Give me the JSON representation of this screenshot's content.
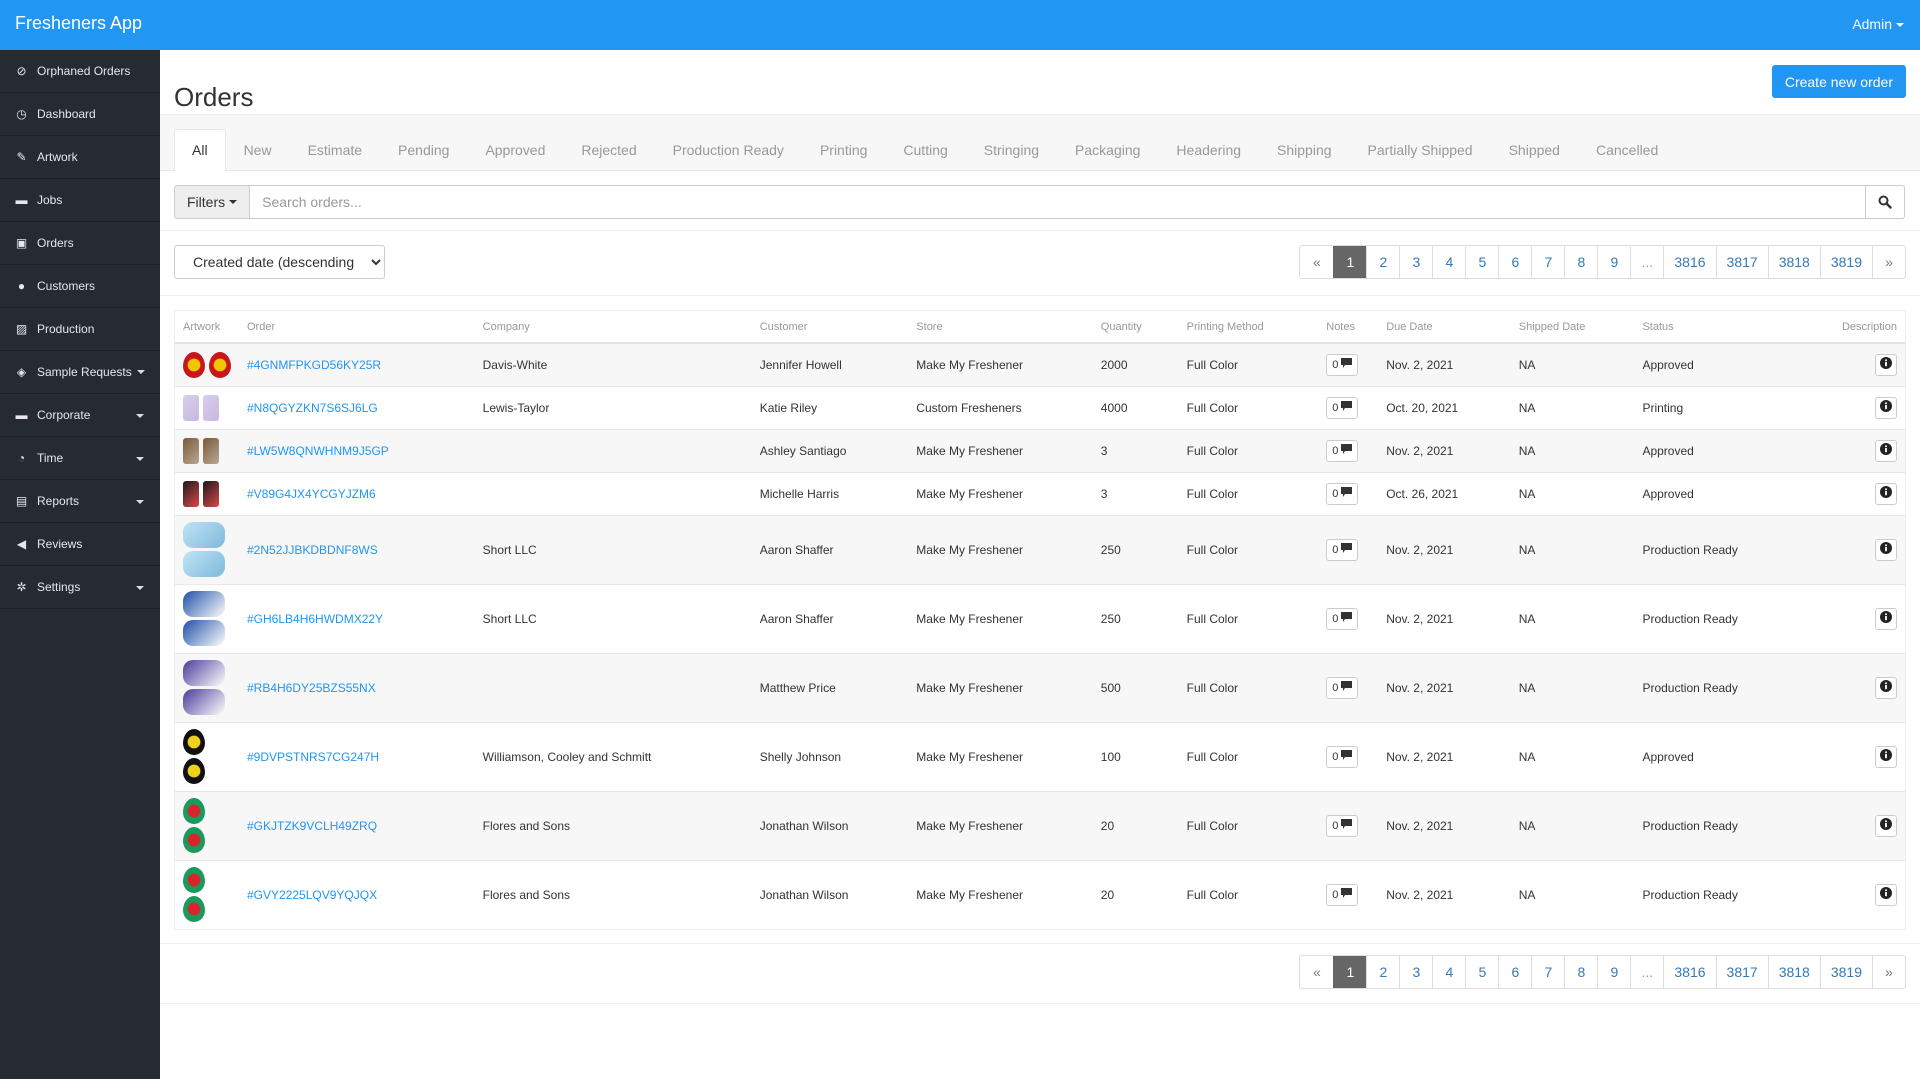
{
  "app": {
    "title": "Fresheners App",
    "user_menu": "Admin"
  },
  "sidebar": {
    "items": [
      {
        "label": "Orphaned Orders",
        "icon": "ban-icon",
        "glyph": "⊘",
        "has_caret": false
      },
      {
        "label": "Dashboard",
        "icon": "dashboard-icon",
        "glyph": "◷",
        "has_caret": false
      },
      {
        "label": "Artwork",
        "icon": "pushpin-icon",
        "glyph": "✎",
        "has_caret": false
      },
      {
        "label": "Jobs",
        "icon": "briefcase-icon",
        "glyph": "▬",
        "has_caret": false
      },
      {
        "label": "Orders",
        "icon": "inbox-icon",
        "glyph": "▣",
        "has_caret": false
      },
      {
        "label": "Customers",
        "icon": "user-icon",
        "glyph": "●",
        "has_caret": false
      },
      {
        "label": "Production",
        "icon": "picture-icon",
        "glyph": "▨",
        "has_caret": false
      },
      {
        "label": "Sample Requests",
        "icon": "tags-icon",
        "glyph": "◈",
        "has_caret": true,
        "caret_inline": true
      },
      {
        "label": "Corporate",
        "icon": "briefcase-icon",
        "glyph": "▬",
        "has_caret": true
      },
      {
        "label": "Time",
        "icon": "clock-icon",
        "glyph": "◔",
        "has_caret": true
      },
      {
        "label": "Reports",
        "icon": "list-alt-icon",
        "glyph": "▤",
        "has_caret": true
      },
      {
        "label": "Reviews",
        "icon": "bullhorn-icon",
        "glyph": "◀",
        "has_caret": false
      },
      {
        "label": "Settings",
        "icon": "cog-icon",
        "glyph": "✲",
        "has_caret": true
      }
    ]
  },
  "page": {
    "title": "Orders",
    "create_button": "Create new order"
  },
  "tabs": [
    "All",
    "New",
    "Estimate",
    "Pending",
    "Approved",
    "Rejected",
    "Production Ready",
    "Printing",
    "Cutting",
    "Stringing",
    "Packaging",
    "Headering",
    "Shipping",
    "Partially Shipped",
    "Shipped",
    "Cancelled"
  ],
  "active_tab": "All",
  "search": {
    "filters_label": "Filters",
    "placeholder": "Search orders...",
    "value": ""
  },
  "sort": {
    "selected": "Created date (descending)"
  },
  "pagination": {
    "prev": "«",
    "next": "»",
    "pages": [
      "1",
      "2",
      "3",
      "4",
      "5",
      "6",
      "7",
      "8",
      "9",
      "...",
      "3816",
      "3817",
      "3818",
      "3819"
    ],
    "current": "1"
  },
  "table": {
    "columns": [
      "Artwork",
      "Order",
      "Company",
      "Customer",
      "Store",
      "Quantity",
      "Printing Method",
      "Notes",
      "Due Date",
      "Shipped Date",
      "Status",
      "Description"
    ],
    "rows": [
      {
        "artwork": {
          "style": "side",
          "shape": "round",
          "colors": [
            "#c8161d",
            "#f5c400"
          ]
        },
        "order": "#4GNMFPKGD56KY25R",
        "company": "Davis-White",
        "customer": "Jennifer Howell",
        "store": "Make My Freshener",
        "quantity": "2000",
        "printing_method": "Full Color",
        "notes": "0",
        "due_date": "Nov. 2, 2021",
        "shipped_date": "NA",
        "status": "Approved"
      },
      {
        "artwork": {
          "style": "side",
          "shape": "rect",
          "colors": [
            "#d7d0ea",
            "#c9b6e0"
          ]
        },
        "order": "#N8QGYZKN7S6SJ6LG",
        "company": "Lewis-Taylor",
        "customer": "Katie Riley",
        "store": "Custom Fresheners",
        "quantity": "4000",
        "printing_method": "Full Color",
        "notes": "0",
        "due_date": "Oct. 20, 2021",
        "shipped_date": "NA",
        "status": "Printing"
      },
      {
        "artwork": {
          "style": "side",
          "shape": "rect",
          "colors": [
            "#7a5a3a",
            "#b9a894"
          ]
        },
        "order": "#LW5W8QNWHNM9J5GP",
        "company": "",
        "customer": "Ashley Santiago",
        "store": "Make My Freshener",
        "quantity": "3",
        "printing_method": "Full Color",
        "notes": "0",
        "due_date": "Nov. 2, 2021",
        "shipped_date": "NA",
        "status": "Approved"
      },
      {
        "artwork": {
          "style": "side",
          "shape": "rect",
          "colors": [
            "#1a1a1a",
            "#e0454a"
          ]
        },
        "order": "#V89G4JX4YCGYJZM6",
        "company": "",
        "customer": "Michelle Harris",
        "store": "Make My Freshener",
        "quantity": "3",
        "printing_method": "Full Color",
        "notes": "0",
        "due_date": "Oct. 26, 2021",
        "shipped_date": "NA",
        "status": "Approved"
      },
      {
        "artwork": {
          "style": "stack",
          "shape": "big",
          "colors": [
            "#bfe4f6",
            "#7fb8da"
          ]
        },
        "order": "#2N52JJBKDBDNF8WS",
        "company": "Short LLC",
        "customer": "Aaron Shaffer",
        "store": "Make My Freshener",
        "quantity": "250",
        "printing_method": "Full Color",
        "notes": "0",
        "due_date": "Nov. 2, 2021",
        "shipped_date": "NA",
        "status": "Production Ready"
      },
      {
        "artwork": {
          "style": "stack",
          "shape": "big",
          "colors": [
            "#1f4fa6",
            "#ffffff"
          ]
        },
        "order": "#GH6LB4H6HWDMX22Y",
        "company": "Short LLC",
        "customer": "Aaron Shaffer",
        "store": "Make My Freshener",
        "quantity": "250",
        "printing_method": "Full Color",
        "notes": "0",
        "due_date": "Nov. 2, 2021",
        "shipped_date": "NA",
        "status": "Production Ready"
      },
      {
        "artwork": {
          "style": "stack",
          "shape": "big",
          "colors": [
            "#4b3a9a",
            "#ffffff"
          ]
        },
        "order": "#RB4H6DY25BZS55NX",
        "company": "",
        "customer": "Matthew Price",
        "store": "Make My Freshener",
        "quantity": "500",
        "printing_method": "Full Color",
        "notes": "0",
        "due_date": "Nov. 2, 2021",
        "shipped_date": "NA",
        "status": "Production Ready"
      },
      {
        "artwork": {
          "style": "stack",
          "shape": "round",
          "colors": [
            "#111111",
            "#f1d21a"
          ]
        },
        "order": "#9DVPSTNRS7CG247H",
        "company": "Williamson, Cooley and Schmitt",
        "customer": "Shelly Johnson",
        "store": "Make My Freshener",
        "quantity": "100",
        "printing_method": "Full Color",
        "notes": "0",
        "due_date": "Nov. 2, 2021",
        "shipped_date": "NA",
        "status": "Approved"
      },
      {
        "artwork": {
          "style": "stack",
          "shape": "round",
          "colors": [
            "#1a9a5c",
            "#d8242b"
          ]
        },
        "order": "#GKJTZK9VCLH49ZRQ",
        "company": "Flores and Sons",
        "customer": "Jonathan Wilson",
        "store": "Make My Freshener",
        "quantity": "20",
        "printing_method": "Full Color",
        "notes": "0",
        "due_date": "Nov. 2, 2021",
        "shipped_date": "NA",
        "status": "Production Ready"
      },
      {
        "artwork": {
          "style": "stack",
          "shape": "round",
          "colors": [
            "#1a9a5c",
            "#d8242b"
          ]
        },
        "order": "#GVY2225LQV9YQJQX",
        "company": "Flores and Sons",
        "customer": "Jonathan Wilson",
        "store": "Make My Freshener",
        "quantity": "20",
        "printing_method": "Full Color",
        "notes": "0",
        "due_date": "Nov. 2, 2021",
        "shipped_date": "NA",
        "status": "Production Ready"
      }
    ]
  },
  "colors": {
    "brand": "#2196f3",
    "sidebar": "#262a33",
    "link": "#2196f3",
    "pager_active": "#666666"
  }
}
